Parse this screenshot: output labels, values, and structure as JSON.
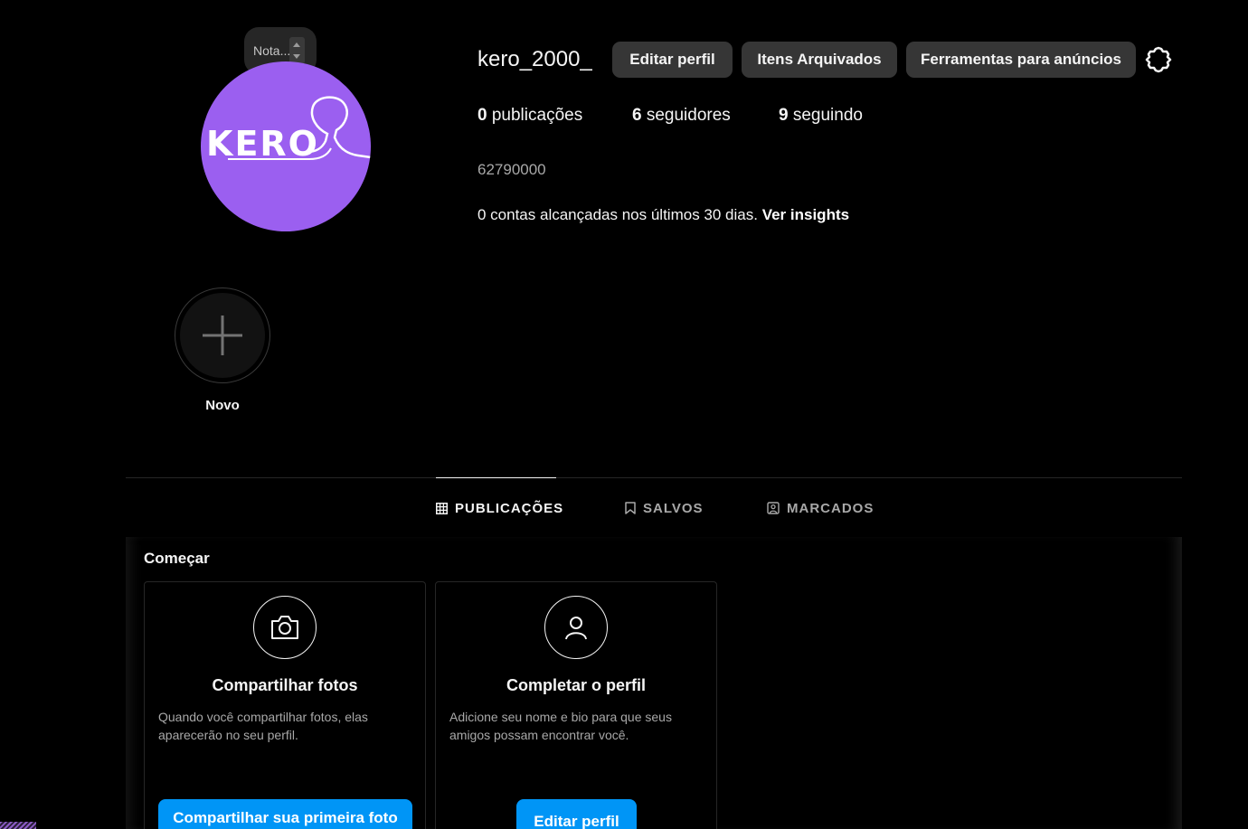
{
  "note": {
    "placeholder": "Nota..."
  },
  "avatar": {
    "logo_text": "KERO",
    "bg_color": "#9b5ff0"
  },
  "header": {
    "username": "kero_2000_",
    "edit_profile_label": "Editar perfil",
    "archived_label": "Itens Arquivados",
    "ad_tools_label": "Ferramentas para anúncios",
    "settings_icon": "gear-icon"
  },
  "stats": {
    "posts_count": "0",
    "posts_label": "publicações",
    "followers_count": "6",
    "followers_label": "seguidores",
    "following_count": "9",
    "following_label": "seguindo"
  },
  "bio": {
    "number": "62790000",
    "reach_text": "0 contas alcançadas nos últimos 30 dias.",
    "insights_link": "Ver insights"
  },
  "highlight": {
    "new_label": "Novo",
    "icon": "plus-icon"
  },
  "tabs": [
    {
      "label": "PUBLICAÇÕES",
      "icon": "grid-icon",
      "active": true
    },
    {
      "label": "SALVOS",
      "icon": "bookmark-icon",
      "active": false
    },
    {
      "label": "MARCADOS",
      "icon": "tagged-icon",
      "active": false
    }
  ],
  "get_started": {
    "title": "Começar",
    "cards": [
      {
        "icon": "camera-icon",
        "title": "Compartilhar fotos",
        "description": "Quando você compartilhar fotos, elas aparecerão no seu perfil.",
        "button": "Compartilhar sua primeira foto"
      },
      {
        "icon": "user-icon",
        "title": "Completar o perfil",
        "description": "Adicione seu nome e bio para que seus amigos possam encontrar você.",
        "button": "Editar perfil"
      }
    ]
  },
  "colors": {
    "accent": "#0095f6",
    "button_bg": "#363636",
    "background": "#000000"
  }
}
